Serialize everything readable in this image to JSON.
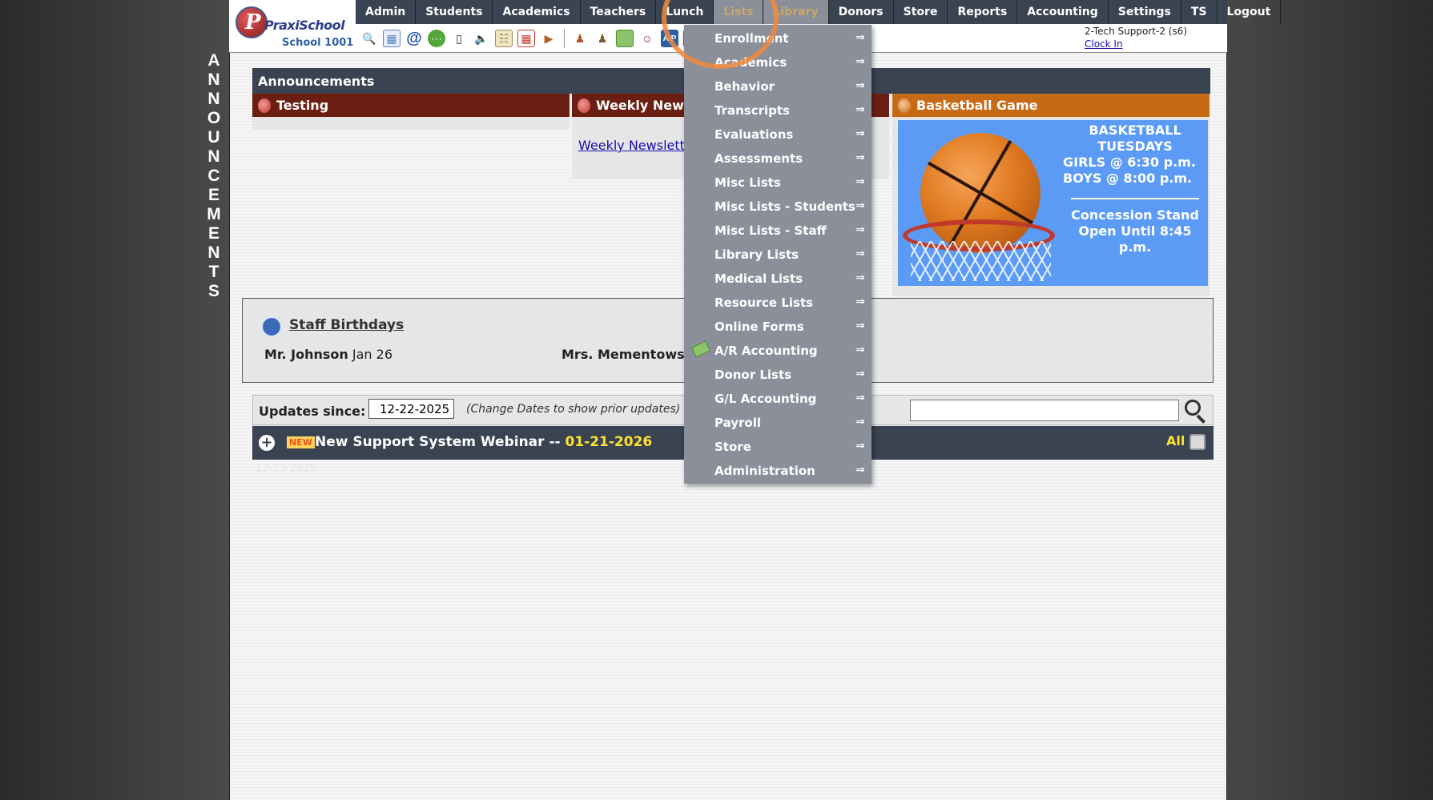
{
  "app": {
    "brand": "PraxiSchool",
    "school": "School 1001",
    "vertical_banner": [
      "A",
      "N",
      "N",
      "O",
      "U",
      "N",
      "C",
      "E",
      "M",
      "E",
      "N",
      "T",
      "S"
    ]
  },
  "menu": {
    "items": [
      "Admin",
      "Students",
      "Academics",
      "Teachers",
      "Lunch",
      "Lists",
      "Library",
      "Donors",
      "Store",
      "Reports",
      "Accounting",
      "Settings",
      "TS",
      "Logout"
    ],
    "active": "Lists"
  },
  "toolbar": {
    "icons": [
      "search-icon",
      "grid-icon",
      "at-icon",
      "chat-icon",
      "phone-icon",
      "speaker-icon",
      "schedule-icon",
      "calendar-icon",
      "megaphone-icon",
      "teacher-icon",
      "student-icon",
      "money-icon",
      "users-icon",
      "ap-icon",
      "pdf-icon",
      "cash-icon",
      "help-icon",
      "power-icon"
    ]
  },
  "user": {
    "name": "2-Tech Support-2 (s6)",
    "clock_in": "Clock In"
  },
  "announcements": {
    "header": "Announcements",
    "panels": [
      {
        "title": "Testing",
        "color": "#6b1f12"
      },
      {
        "title": "Weekly Newsl",
        "link": "Weekly Newslette",
        "color": "#6b1f12"
      },
      {
        "title": "Basketball Game",
        "color": "#c76a15"
      }
    ],
    "basketball": {
      "line1": "BASKETBALL",
      "line2": "TUESDAYS",
      "line3": "GIRLS @ 6:30 p.m.",
      "line4": "BOYS  @ 8:00 p.m.",
      "line5": "Concession Stand",
      "line6": "Open Until 8:45 p.m."
    }
  },
  "birthdays": {
    "title": "Staff Birthdays",
    "entries": [
      {
        "name": "Mr. Johnson",
        "date": "Jan 26"
      },
      {
        "name": "Mrs. Mementowsk",
        "date": ""
      }
    ]
  },
  "updates": {
    "label": "Updates since:",
    "date": "12-22-2025",
    "note": "(Change Dates to show prior updates)",
    "search_placeholder": ""
  },
  "news": {
    "badge": "NEW",
    "title": "New Support System Webinar -- ",
    "date": "01-21-2026",
    "all": "All",
    "faint": "12-23-2025"
  },
  "dropdown": {
    "items": [
      "Enrollment",
      "Academics",
      "Behavior",
      "Transcripts",
      "Evaluations",
      "Assessments",
      "Misc Lists",
      "Misc Lists - Students",
      "Misc Lists - Staff",
      "Library Lists",
      "Medical Lists",
      "Resource Lists",
      "Online Forms",
      "A/R Accounting",
      "Donor Lists",
      "G/L Accounting",
      "Payroll",
      "Store",
      "Administration"
    ],
    "arrow": "⇒"
  }
}
